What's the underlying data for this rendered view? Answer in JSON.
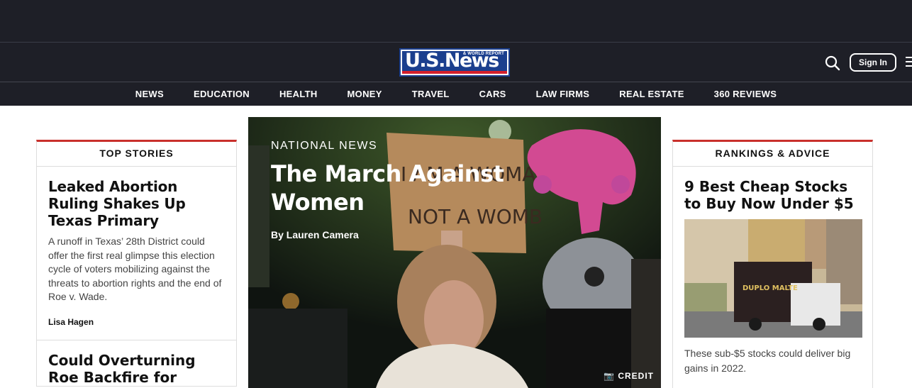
{
  "brand": {
    "logo_text": "U.S.News",
    "logo_sub": "& WORLD REPORT"
  },
  "header": {
    "signin_label": "Sign In"
  },
  "nav": {
    "items": [
      "NEWS",
      "EDUCATION",
      "HEALTH",
      "MONEY",
      "TRAVEL",
      "CARS",
      "LAW FIRMS",
      "REAL ESTATE",
      "360 REVIEWS"
    ]
  },
  "top_stories": {
    "heading": "TOP STORIES",
    "stories": [
      {
        "title": "Leaked Abortion Ruling Shakes Up Texas Primary",
        "summary": "A runoff in Texas’ 28th District could offer the first real glimpse this election cycle of voters mobilizing against the threats to abortion rights and the end of Roe v. Wade.",
        "author": "Lisa Hagen"
      },
      {
        "title": "Could Overturning Roe Backfire for"
      }
    ]
  },
  "hero": {
    "kicker": "NATIONAL NEWS",
    "title": "The March Against Women",
    "byline_prefix": "By",
    "author": "Lauren Camera",
    "credit": "CREDIT",
    "sign_text_1": "I AM A WOMAN",
    "sign_text_2": "NOT A WOMB"
  },
  "rankings": {
    "heading": "RANKINGS & ADVICE",
    "story": {
      "title": "9 Best Cheap Stocks to Buy Now Under $5",
      "summary": "These sub-$5 stocks could deliver big gains in 2022.",
      "truck_text": "DUPLO MALTE"
    }
  },
  "colors": {
    "bg_dark": "#1e1f27",
    "accent_red": "#c9302c",
    "logo_blue": "#1b3f8e"
  }
}
